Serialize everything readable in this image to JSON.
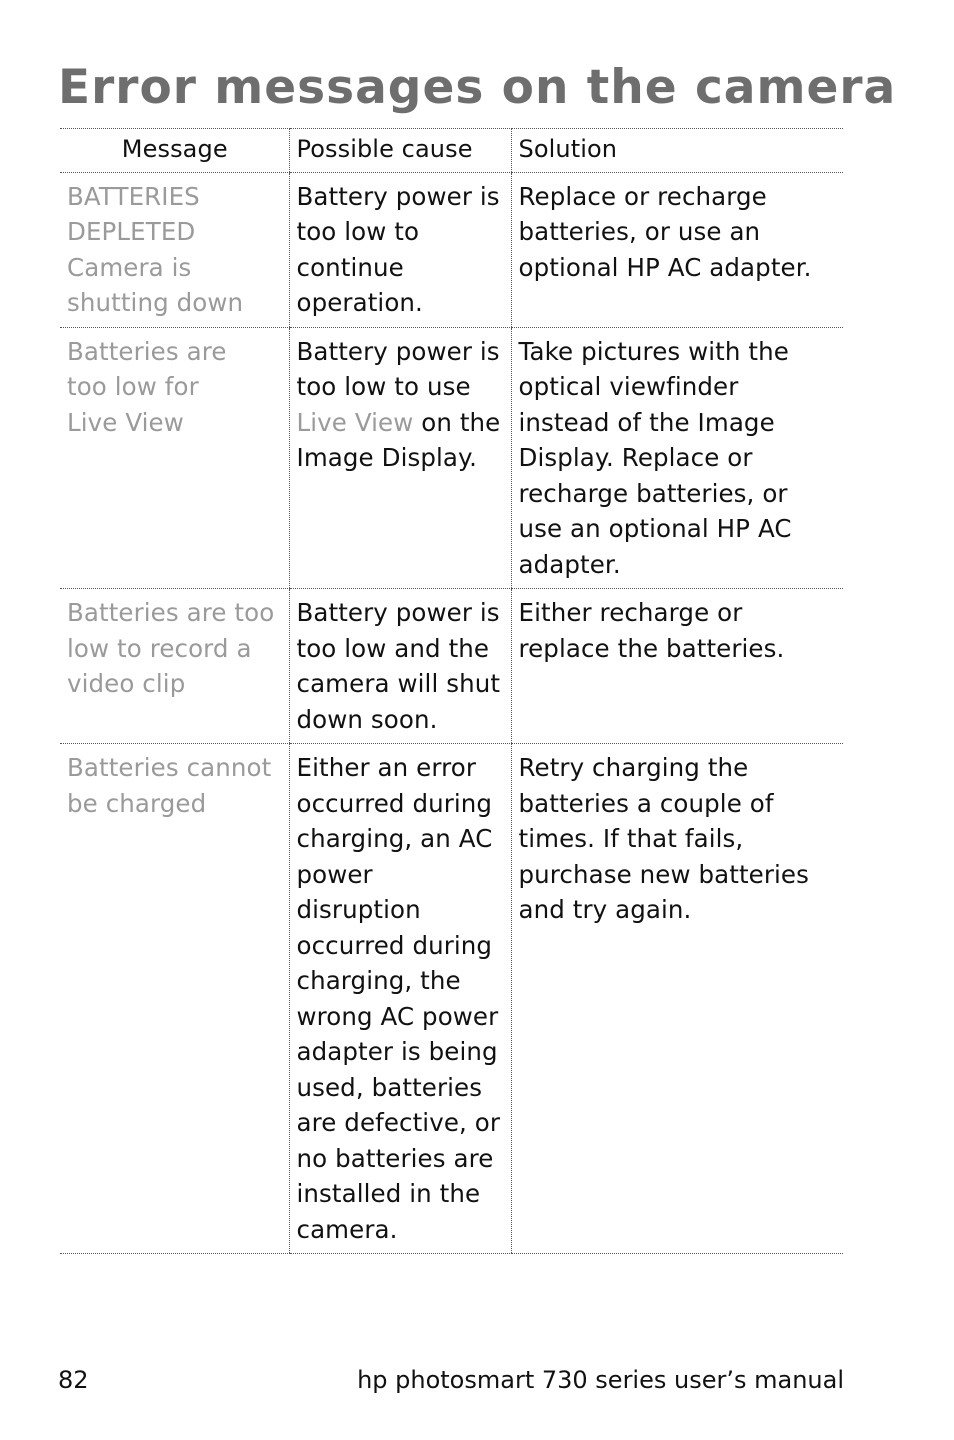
{
  "page": {
    "title": "Error messages on the camera",
    "table": {
      "headers": [
        "Message",
        "Possible cause",
        "Solution"
      ],
      "rows": [
        {
          "message": [
            "BATTERIES",
            "DEPLETED",
            "Camera is",
            "shutting down"
          ],
          "cause": "Battery power is too low to continue operation.",
          "solution": "Replace or recharge batteries, or use an optional HP AC adapter."
        },
        {
          "message": [
            "Batteries are",
            "too low for",
            "Live View"
          ],
          "cause_before": "Battery power is too low to use ",
          "cause_highlight": "Live View",
          "cause_after": " on the Image Display.",
          "solution": "Take pictures with the optical viewfinder instead of the Image Display. Replace or recharge batteries, or use an optional HP AC adapter."
        },
        {
          "message": [
            "Batteries are too",
            "low to record a",
            "video clip"
          ],
          "cause": "Battery power is too low and the camera will shut down soon.",
          "solution": "Either recharge or replace the batteries."
        },
        {
          "message": [
            "Batteries cannot",
            "be charged"
          ],
          "cause": "Either an error occurred during charging, an AC power disruption occurred during charging, the wrong AC power adapter is being used, batteries are defective, or no batteries are installed in the camera.",
          "solution": "Retry charging the batteries a couple of times. If that fails, purchase new batteries and try again."
        }
      ]
    },
    "footer": {
      "page_number": "82",
      "manual_title": "hp photosmart 730 series user’s manual"
    }
  }
}
